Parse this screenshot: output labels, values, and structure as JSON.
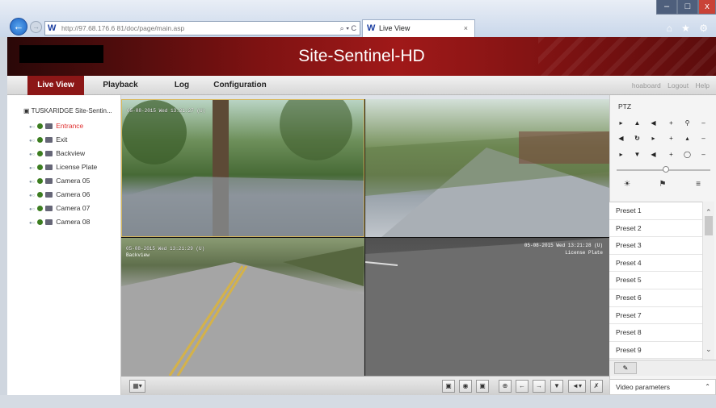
{
  "browser": {
    "url": "http://97.68.176.6 81/doc/page/main.asp",
    "tab_title": "Live View",
    "addr_tools": "⌕ ▾ C",
    "right_tools": "⌂ ★ ⚙",
    "win_buttons": [
      "–",
      "□",
      "x"
    ]
  },
  "banner": {
    "title": "Site-Sentinel-HD"
  },
  "menu": {
    "items": [
      "Live View",
      "Playback",
      "Log",
      "Configuration"
    ],
    "right_links": [
      "hoaboard",
      "Logout",
      "Help"
    ]
  },
  "device_tree": {
    "device": "TUSKARIDGE Site-Sentin...",
    "cameras": [
      "Entrance",
      "Exit",
      "Backview",
      "License Plate",
      "Camera 05",
      "Camera 06",
      "Camera 07",
      "Camera 08"
    ],
    "selected": "Entrance"
  },
  "feeds": {
    "f1_osd": "05-08-2015 Wed 13:21:27 (U)",
    "f3_osd": "05-08-2015 Wed 13:21:29 (U)",
    "f3_name": "Backview",
    "f4_osd": "05-08-2015 Wed 13:21:28 (U)",
    "f4_name": "License Plate"
  },
  "ptz": {
    "label": "PTZ",
    "presets": [
      "Preset 1",
      "Preset 2",
      "Preset 3",
      "Preset 4",
      "Preset 5",
      "Preset 6",
      "Preset 7",
      "Preset 8",
      "Preset 9"
    ],
    "video_params": "Video parameters"
  },
  "colors": {
    "accent": "#8c1717",
    "selected_camera": "#e03030"
  }
}
